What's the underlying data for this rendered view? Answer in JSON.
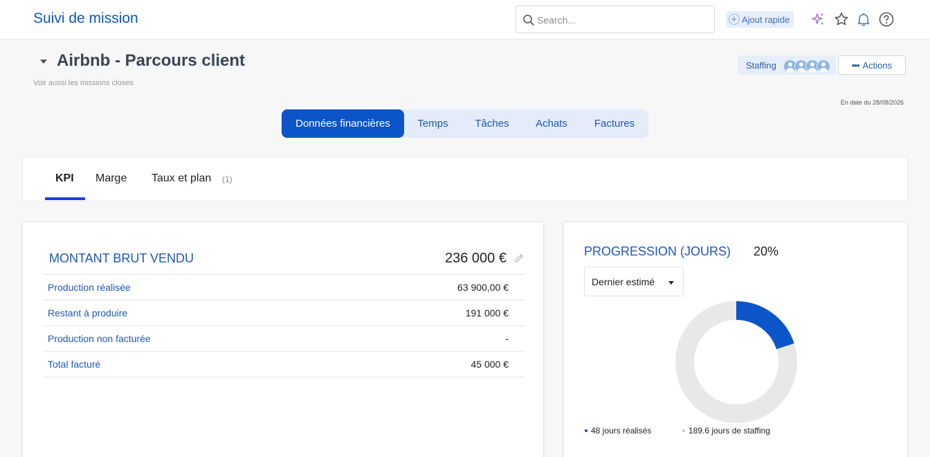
{
  "app": {
    "title": "Suivi de mission"
  },
  "search": {
    "placeholder": "Search..."
  },
  "topbar": {
    "quick_add": "Ajout rapide"
  },
  "colors": {
    "accent": "#0b55c8",
    "progress": "#0b55c8",
    "track": "#e8e8e8",
    "remaining_dot": "#c8c8c8"
  },
  "header": {
    "title": "Airbnb - Parcours client",
    "closed_link": "Voir aussi les missions closes",
    "staffing_label": "Staffing",
    "actions_label": "Actions",
    "as_of": "En date du 28/08/2026"
  },
  "main_tabs": [
    {
      "label": "Données financières",
      "active": true
    },
    {
      "label": "Temps",
      "active": false
    },
    {
      "label": "Tâches",
      "active": false
    },
    {
      "label": "Achats",
      "active": false
    },
    {
      "label": "Factures",
      "active": false
    }
  ],
  "sub_tabs": [
    {
      "label": "KPI",
      "active": true
    },
    {
      "label": "Marge",
      "active": false
    },
    {
      "label": "Taux et plan",
      "count": "(1)",
      "active": false
    }
  ],
  "gross": {
    "label": "MONTANT BRUT VENDU",
    "value": "236 000 €",
    "rows": [
      {
        "label": "Production réalisée",
        "value": "63 900,00 €"
      },
      {
        "label": "Restant à produire",
        "value": "191 000 €"
      },
      {
        "label": "Production non facturée",
        "value": "-"
      },
      {
        "label": "Total facturé",
        "value": "45 000 €"
      }
    ]
  },
  "progress": {
    "label": "PROGRESSION (JOURS)",
    "value": "20%",
    "fraction": 0.2,
    "select_value": "Dernier estimé",
    "legend_done": "48 jours réalisés",
    "legend_staffing": "189.6 jours de staffing"
  }
}
